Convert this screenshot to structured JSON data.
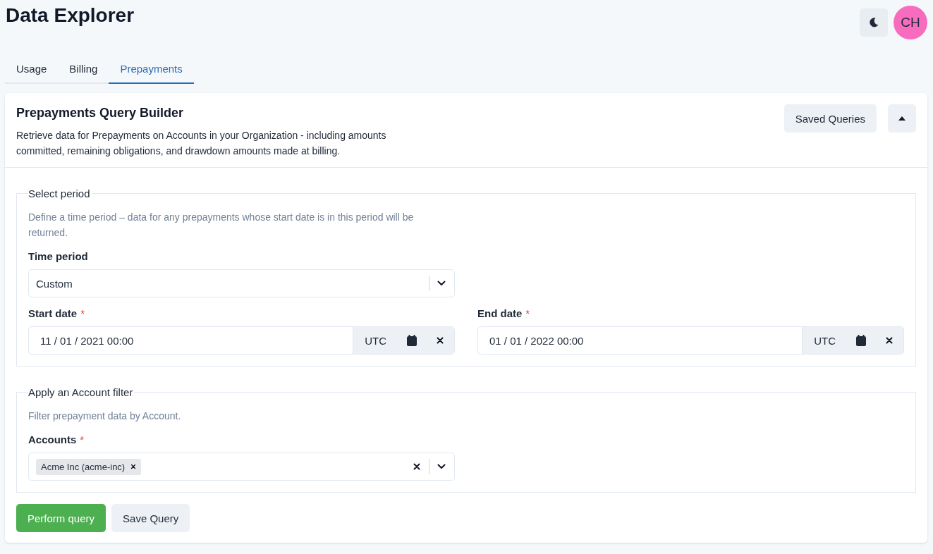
{
  "header": {
    "title": "Data Explorer",
    "avatar": {
      "initials": "CH",
      "color": "#f86cc0"
    }
  },
  "tabs": [
    {
      "label": "Usage",
      "selected": false
    },
    {
      "label": "Billing",
      "selected": false
    },
    {
      "label": "Prepayments",
      "selected": true
    }
  ],
  "required_marker": "*",
  "card": {
    "title": "Prepayments Query Builder",
    "description": "Retrieve data for Prepayments on Accounts in your Organization - including amounts committed, remaining obligations, and drawdown amounts made at billing.",
    "saved_queries_button": "Saved Queries",
    "expanded": true
  },
  "sections": [
    {
      "legend": "Select period",
      "hint": "Define a time period – data for any prepayments whose start date is in this period will be returned.",
      "rows": [
        [
          {
            "kind": "select",
            "label": "Time period",
            "required": false,
            "value": "Custom"
          }
        ],
        [
          {
            "kind": "date",
            "label": "Start date",
            "required": true,
            "value": "11 / 01 / 2021 00:00",
            "timezone": "UTC"
          },
          {
            "kind": "date",
            "label": "End date",
            "required": true,
            "value": "01 / 01 / 2022 00:00",
            "timezone": "UTC"
          }
        ]
      ]
    },
    {
      "legend": "Apply an Account filter",
      "hint": "Filter prepayment data by Account.",
      "rows": [
        [
          {
            "kind": "multiselect",
            "label": "Accounts",
            "required": true,
            "chips": [
              "Acme Inc (acme-inc)"
            ]
          }
        ]
      ]
    }
  ],
  "actions": {
    "primary": "Perform query",
    "secondary": "Save Query"
  }
}
